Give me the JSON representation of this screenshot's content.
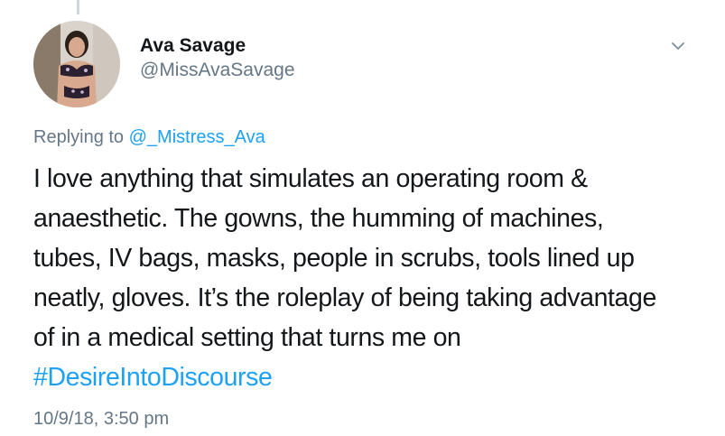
{
  "user": {
    "display_name": "Ava Savage",
    "handle": "@MissAvaSavage",
    "avatar_icon": "profile-photo-avatar"
  },
  "menu": {
    "icon": "chevron-down-icon"
  },
  "reply": {
    "prefix": "Replying to",
    "mention": "@_Mistress_Ava"
  },
  "tweet": {
    "lines": [
      "I love anything that simulates an operating room &",
      "anaesthetic. The gowns, the humming of machines,",
      "tubes, IV bags, masks, people in scrubs, tools lined up",
      "neatly, gloves. It’s the roleplay of being taking advantage",
      "of in a medical setting that turns me on"
    ],
    "hashtag": "#DesireIntoDiscourse"
  },
  "timestamp": "10/9/18, 3:50 pm",
  "colors": {
    "link": "#1da1f2",
    "secondary_text": "#657786",
    "primary_text": "#14171a"
  }
}
